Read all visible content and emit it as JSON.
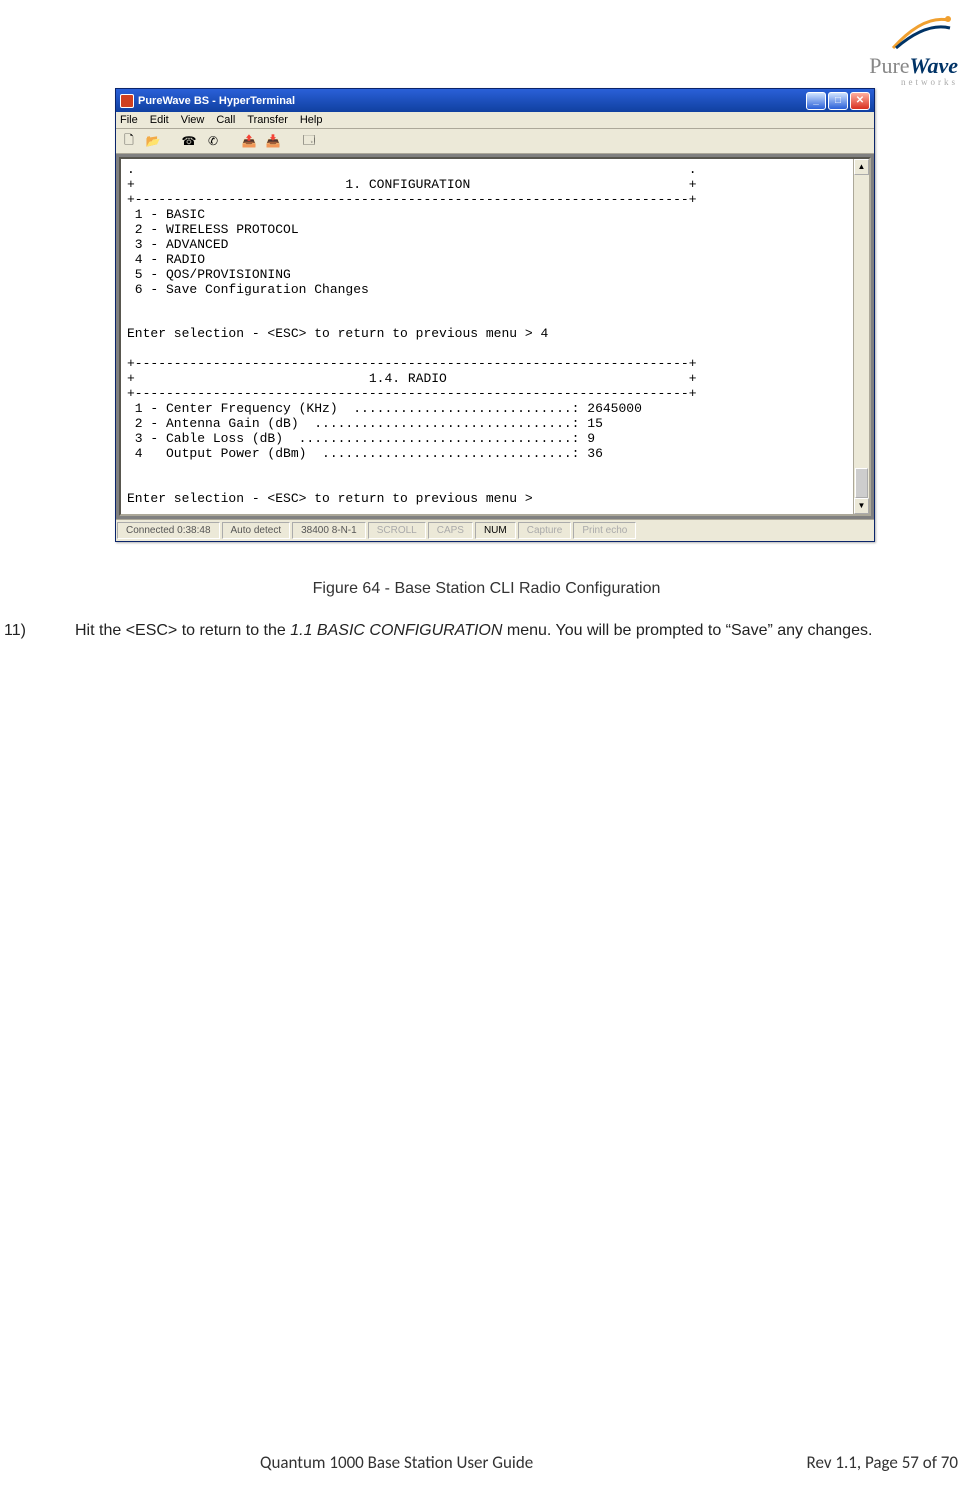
{
  "logo": {
    "brand_a": "Pure",
    "brand_b": "Wave",
    "sub": "networks"
  },
  "window": {
    "title": "PureWave BS - HyperTerminal",
    "menu": [
      "File",
      "Edit",
      "View",
      "Call",
      "Transfer",
      "Help"
    ]
  },
  "terminal": {
    "header1_title": "1. CONFIGURATION",
    "menu1": [
      "1 - BASIC",
      "2 - WIRELESS PROTOCOL",
      "3 - ADVANCED",
      "4 - RADIO",
      "5 - QOS/PROVISIONING",
      "6 - Save Configuration Changes"
    ],
    "prompt1": "Enter selection - <ESC> to return to previous menu > 4",
    "header2_title": "1.4. RADIO",
    "radio": [
      {
        "label": "1 - Center Frequency (KHz)",
        "dots": "............................",
        "value": "2645000"
      },
      {
        "label": "2 - Antenna Gain (dB)",
        "dots": ".................................",
        "value": "15"
      },
      {
        "label": "3 - Cable Loss (dB)",
        "dots": "...................................",
        "value": "9"
      },
      {
        "label": "4   Output Power (dBm)",
        "dots": "................................",
        "value": "36"
      }
    ],
    "prompt2": "Enter selection - <ESC> to return to previous menu >"
  },
  "status": {
    "connected": "Connected 0:38:48",
    "autodetect": "Auto detect",
    "baud": "38400 8-N-1",
    "scroll": "SCROLL",
    "caps": "CAPS",
    "num": "NUM",
    "capture": "Capture",
    "printecho": "Print echo"
  },
  "figure_caption": "Figure 64 - Base Station CLI Radio Configuration",
  "step": {
    "num": "11)",
    "pre": "Hit the <ESC> to return to the ",
    "italic": "1.1 BASIC CONFIGURATION",
    "post": " menu. You will be prompted to “Save” any changes."
  },
  "footer": {
    "left": "Quantum 1000 Base Station User Guide",
    "right": "Rev 1.1, Page 57 of 70"
  }
}
